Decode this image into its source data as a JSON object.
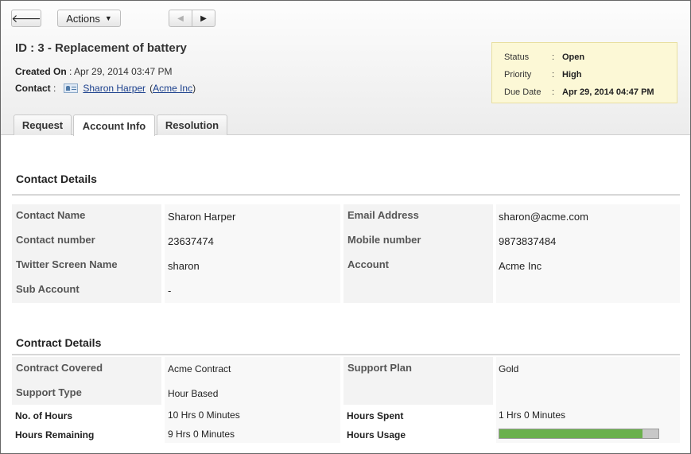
{
  "toolbar": {
    "back_glyph": "🡐",
    "actions_label": "Actions",
    "prev_glyph": "◀",
    "next_glyph": "▶"
  },
  "ticket": {
    "title": "ID : 3 - Replacement of battery",
    "created_label": "Created On",
    "created_value": "Apr 29, 2014 03:47 PM",
    "contact_label": "Contact",
    "contact_name": "Sharon Harper",
    "account_open": "(",
    "account_name": "Acme Inc",
    "account_close": ")"
  },
  "status_box": {
    "status_label": "Status",
    "status_value": "Open",
    "priority_label": "Priority",
    "priority_value": "High",
    "due_label": "Due Date",
    "due_value": "Apr 29, 2014 04:47 PM",
    "separator": ":"
  },
  "tabs": [
    {
      "label": "Request"
    },
    {
      "label": "Account Info"
    },
    {
      "label": "Resolution"
    }
  ],
  "contact_details": {
    "title": "Contact Details",
    "rows": [
      {
        "l1": "Contact Name",
        "v1": "Sharon Harper",
        "l2": "Email Address",
        "v2": "sharon@acme.com"
      },
      {
        "l1": "Contact number",
        "v1": "23637474",
        "l2": "Mobile number",
        "v2": "9873837484"
      },
      {
        "l1": "Twitter Screen Name",
        "v1": "sharon",
        "l2": "Account",
        "v2": "Acme Inc"
      },
      {
        "l1": "Sub Account",
        "v1": "-",
        "l2": "",
        "v2": ""
      }
    ]
  },
  "contract_details": {
    "title": "Contract Details",
    "rows": [
      {
        "l1": "Contract Covered",
        "v1": "Acme Contract",
        "l2": "Support Plan",
        "v2": "Gold"
      },
      {
        "l1": "Support Type",
        "v1": "Hour Based",
        "l2": "",
        "v2": ""
      },
      {
        "l1": "No. of Hours",
        "v1": "10 Hrs 0 Minutes",
        "l2": "Hours Spent",
        "v2": "1 Hrs 0 Minutes"
      },
      {
        "l1": "Hours Remaining",
        "v1": "9 Hrs 0 Minutes",
        "l2": "Hours Usage",
        "v2": ""
      }
    ],
    "hours_usage_fraction": 0.9
  },
  "colors": {
    "usage_fill": "#6ab04c",
    "status_box_bg": "#fcf8d6"
  }
}
